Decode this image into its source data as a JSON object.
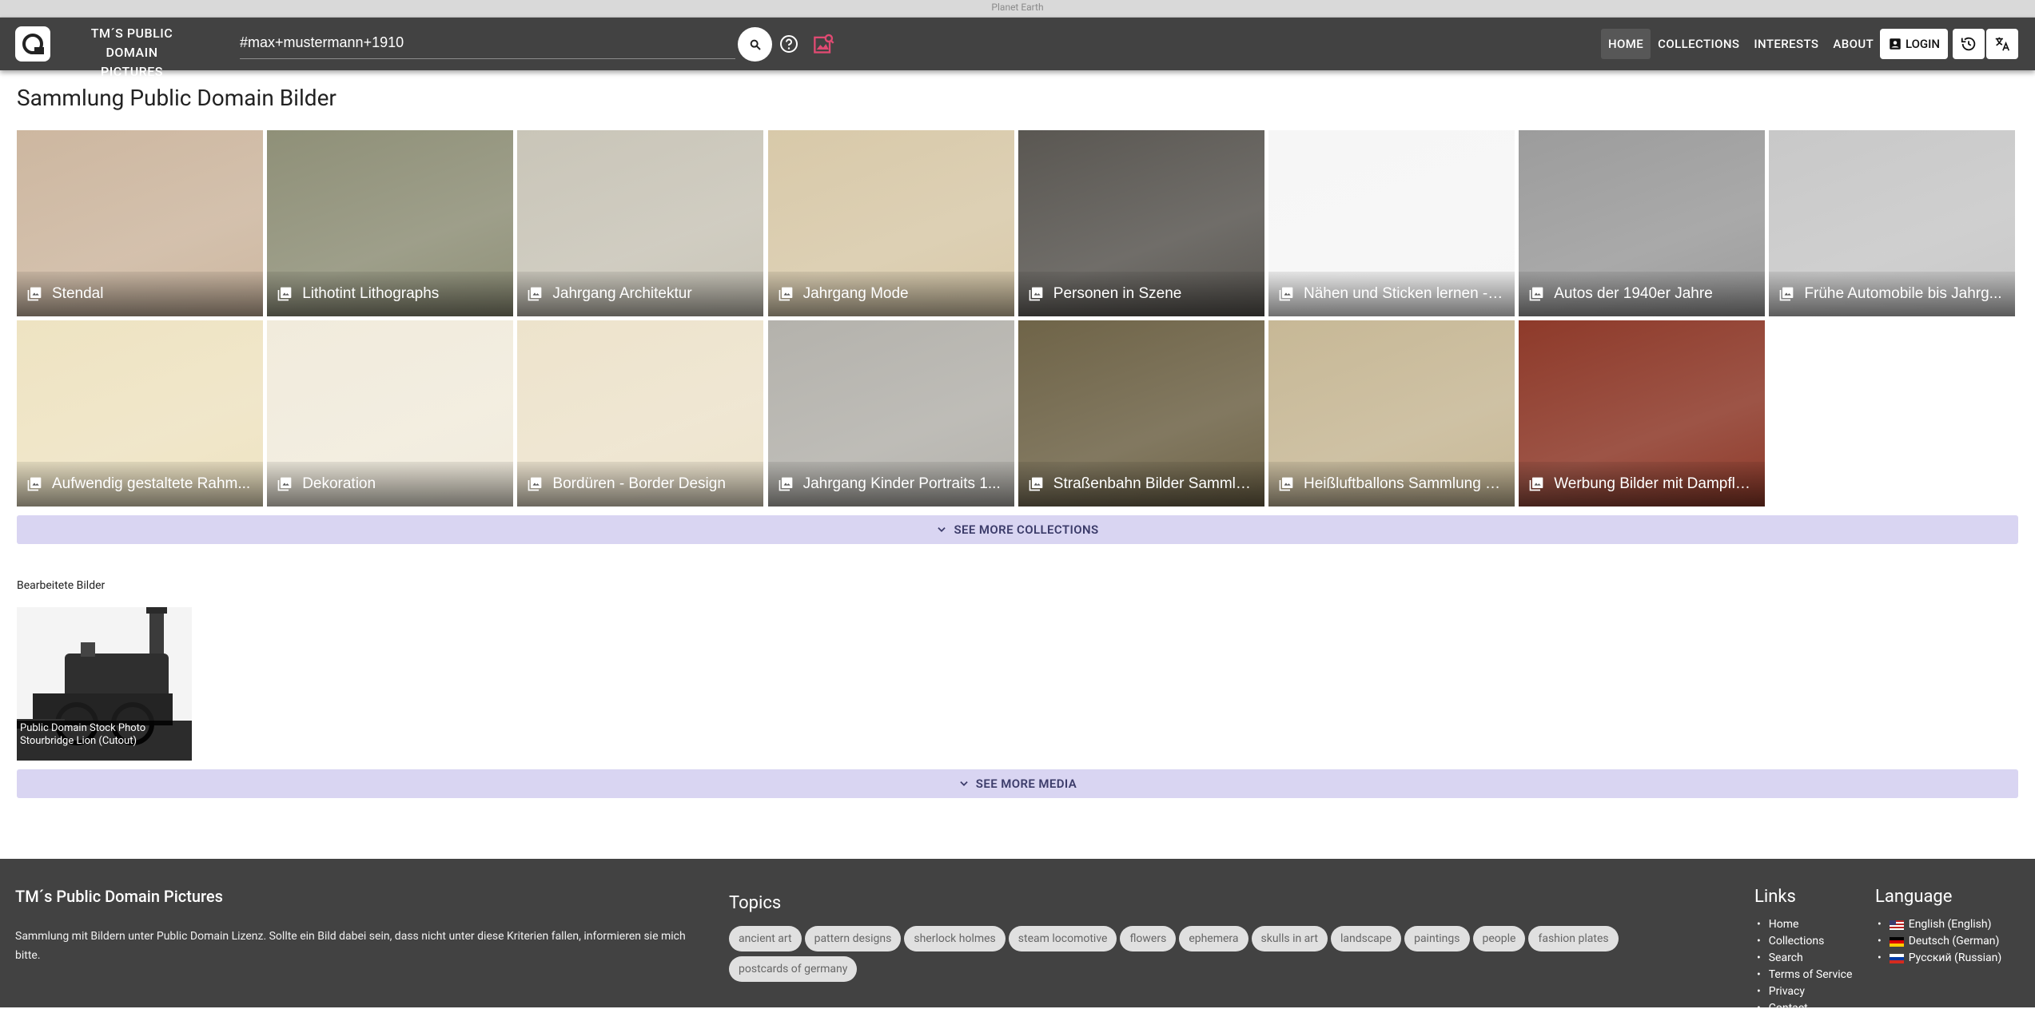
{
  "browser": {
    "tab_title": "Planet Earth"
  },
  "header": {
    "brand_line1": "TM´S PUBLIC DOMAIN",
    "brand_line2": "PICTURES",
    "search_value": "#max+mustermann+1910",
    "nav": [
      "HOME",
      "COLLECTIONS",
      "INTERESTS",
      "ABOUT"
    ],
    "active_nav": "HOME",
    "login_label": "LOGIN"
  },
  "main": {
    "title": "Sammlung Public Domain Bilder",
    "collections": [
      {
        "label": "Stendal",
        "color": "#cdb7a0"
      },
      {
        "label": "Lithotint Lithographs",
        "color": "#8f9078"
      },
      {
        "label": "Jahrgang Architektur",
        "color": "#c9c5b8"
      },
      {
        "label": "Jahrgang Mode",
        "color": "#d8c9a9"
      },
      {
        "label": "Personen in Szene",
        "color": "#5a5752"
      },
      {
        "label": "Nähen und Sticken lernen - Il...",
        "color": "#f6f6f6"
      },
      {
        "label": "Autos der 1940er Jahre",
        "color": "#9c9c9c"
      },
      {
        "label": "Frühe Automobile bis Jahrg...",
        "color": "#c8c8c8"
      },
      {
        "label": "Aufwendig gestaltete Rahm...",
        "color": "#eee3c2"
      },
      {
        "label": "Dekoration",
        "color": "#f1ebdc"
      },
      {
        "label": "Bordüren - Border Design",
        "color": "#ede3cc"
      },
      {
        "label": "Jahrgang Kinder Portraits 1...",
        "color": "#b4b2ac"
      },
      {
        "label": "Straßenbahn Bilder Sammlu...",
        "color": "#6f6448"
      },
      {
        "label": "Heißluftballons Sammlung a...",
        "color": "#c7b896"
      },
      {
        "label": "Werbung Bilder mit Dampflo...",
        "color": "#8e3a2a"
      }
    ],
    "see_more_collections": "SEE MORE COLLECTIONS",
    "edited_label": "Bearbeitete Bilder",
    "edited_media": [
      {
        "caption_line1": "Public Domain Stock Photo",
        "caption_line2": "Stourbridge Lion (Cutout)"
      }
    ],
    "see_more_media": "SEE MORE MEDIA"
  },
  "footer": {
    "title": "TM´s Public Domain Pictures",
    "description": "Sammlung mit Bildern unter Public Domain Lizenz. Sollte ein Bild dabei sein, dass nicht unter diese Kriterien fallen, informieren sie mich bitte.",
    "topics_title": "Topics",
    "topics": [
      "ancient art",
      "pattern designs",
      "sherlock holmes",
      "steam locomotive",
      "flowers",
      "ephemera",
      "skulls in art",
      "landscape",
      "paintings",
      "people",
      "fashion plates",
      "postcards of germany"
    ],
    "links_title": "Links",
    "links": [
      "Home",
      "Collections",
      "Search",
      "Terms of Service",
      "Privacy",
      "Contact"
    ],
    "language_title": "Language",
    "languages": [
      "English (English)",
      "Deutsch (German)",
      "Русский (Russian)"
    ]
  }
}
